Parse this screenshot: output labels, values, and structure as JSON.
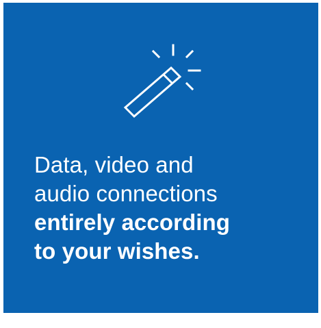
{
  "tile": {
    "background_color": "#0a63b1",
    "text_color": "#ffffff",
    "icon": "magic-wand-icon",
    "lines_regular": [
      "Data, video and",
      "audio connections"
    ],
    "lines_bold": [
      "entirely according",
      "to your wishes."
    ]
  }
}
